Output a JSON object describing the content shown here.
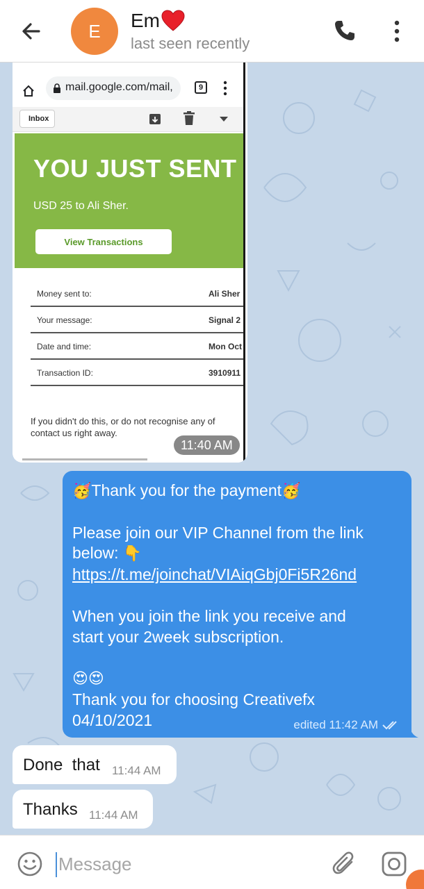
{
  "header": {
    "back_icon": "back-arrow-icon",
    "avatar_letter": "E",
    "avatar_color": "#f0883e",
    "contact_name": "Em",
    "contact_emoji": "heart-icon",
    "status": "last seen recently",
    "call_icon": "phone-icon",
    "menu_icon": "more-vertical-icon"
  },
  "image_message": {
    "browser": {
      "url": "mail.google.com/mail,",
      "tab_count": "9"
    },
    "gmail": {
      "folder": "Inbox"
    },
    "banner": {
      "headline": "YOU JUST SENT",
      "amount_line": "USD 25 to Ali Sher.",
      "button_label": "View Transactions",
      "color": "#86b846"
    },
    "details": [
      {
        "label": "Money sent to:",
        "value": "Ali Sher"
      },
      {
        "label": "Your message:",
        "value": "Signal 2"
      },
      {
        "label": "Date and time:",
        "value": "Mon Oct"
      },
      {
        "label": "Transaction ID:",
        "value": "3910911"
      }
    ],
    "disclaimer_line1": "If you didn't do this, or do not recognise any of",
    "disclaimer_line2": "contact us right away.",
    "time": "11:40 AM"
  },
  "outgoing_message": {
    "line1": "Thank you for the payment",
    "line2": "Please join our VIP Channel from the link",
    "line3": "below: ",
    "link": "https://t.me/joinchat/VIAiqGbj0Fi5R26nd",
    "line4": "When you join the link you receive and",
    "line5": "start your 2week subscription.",
    "line6": "Thank you for choosing Creativefx",
    "line7": "04/10/2021",
    "meta": "edited 11:42 AM",
    "bubble_color": "#3c8fe6",
    "status_icon": "double-check-icon"
  },
  "incoming_messages": [
    {
      "text": "Done  that",
      "time": "11:44 AM"
    },
    {
      "text": "Thanks",
      "time": "11:44 AM"
    }
  ],
  "input": {
    "placeholder": "Message",
    "emoji_icon": "smiley-icon",
    "attach_icon": "paperclip-icon",
    "camera_icon": "camera-icon"
  }
}
